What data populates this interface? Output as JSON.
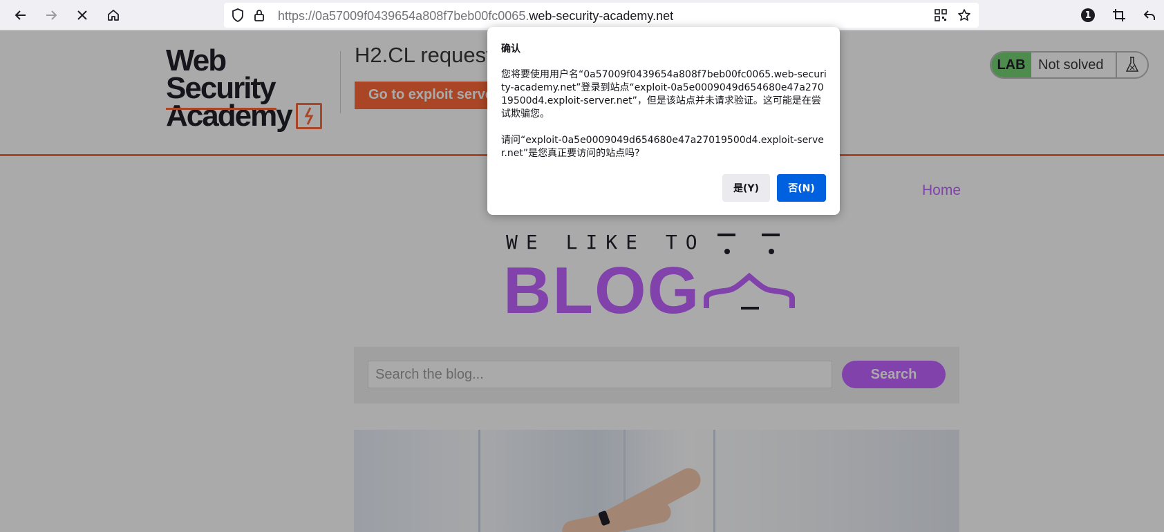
{
  "browser": {
    "url_prefix": "https://0a57009f0439654a808f7beb00fc0065.",
    "url_domain": "web-security-academy.net",
    "notification_count": "1"
  },
  "header": {
    "logo_line1": "Web Security",
    "logo_line2": "Academy",
    "lab_title": "H2.CL request",
    "exploit_button": "Go to exploit server",
    "lab_badge": "LAB",
    "lab_status": "Not solved"
  },
  "nav": {
    "home": "Home"
  },
  "blog": {
    "tagline": "WE LIKE TO",
    "title": "BLOG",
    "search_placeholder": "Search the blog...",
    "search_button": "Search"
  },
  "dialog": {
    "title": "确认",
    "message1": "您将要使用用户名“0a57009f0439654a808f7beb00fc0065.web-security-academy.net”登录到站点“exploit-0a5e0009049d654680e47a27019500d4.exploit-server.net”，但是该站点并未请求验证。这可能是在尝试欺骗您。",
    "message2": "请问“exploit-0a5e0009049d654680e47a27019500d4.exploit-server.net”是您真正要访问的站点吗?",
    "yes_button": "是(Y)",
    "no_button": "否(N)"
  },
  "colors": {
    "accent_orange": "#ff6633",
    "blog_purple": "#c060ff",
    "lab_green": "#70d16d",
    "primary_blue": "#0061e0"
  }
}
